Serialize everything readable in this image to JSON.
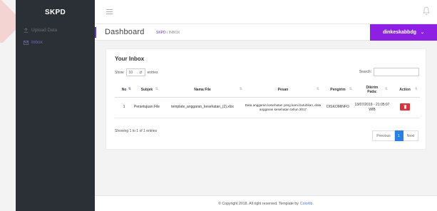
{
  "brand": "SKPD",
  "sidebar": {
    "items": [
      {
        "label": "Upload Data",
        "icon": "upload-icon",
        "active": false
      },
      {
        "label": "Inbox",
        "icon": "mail-icon",
        "active": true
      }
    ]
  },
  "header": {
    "title": "Dashboard",
    "breadcrumb": [
      "SKPD",
      "INBOX"
    ],
    "user": "dinkeskabbdg"
  },
  "card": {
    "title": "Your Inbox",
    "show_label": "Show",
    "show_value": "10",
    "entries_label": "entries",
    "search_label": "Search:",
    "search_value": "",
    "columns": [
      "No",
      "Subjek",
      "Nama File",
      "Pesan",
      "Pengirim",
      "Dikirim Pada:",
      "Action"
    ],
    "rows": [
      {
        "no": "1",
        "subjek": "Persetujuan File",
        "nama_file": "template_anggaran_kesehatan_(2).xlsx",
        "pesan": "Data anggaran kesehatan yang kami butuhkan, data anggaran kesehatan tahun 2017",
        "pengirim": "DISKOMINFO",
        "dikirim": "13/07/2019 - 21:05:07 WIB"
      }
    ],
    "info": "Showing 1 to 1 of 1 entries",
    "pagination": {
      "prev": "Previous",
      "current": "1",
      "next": "Next"
    }
  },
  "footer": {
    "text": "© Copyright 2018. All right reserved. Template by",
    "link": "Colorlib."
  },
  "colors": {
    "sidebar_bg": "#2b2f36",
    "accent_purple": "#8e20e3",
    "delete_red": "#d9343b",
    "page_active": "#2b7fe0"
  }
}
